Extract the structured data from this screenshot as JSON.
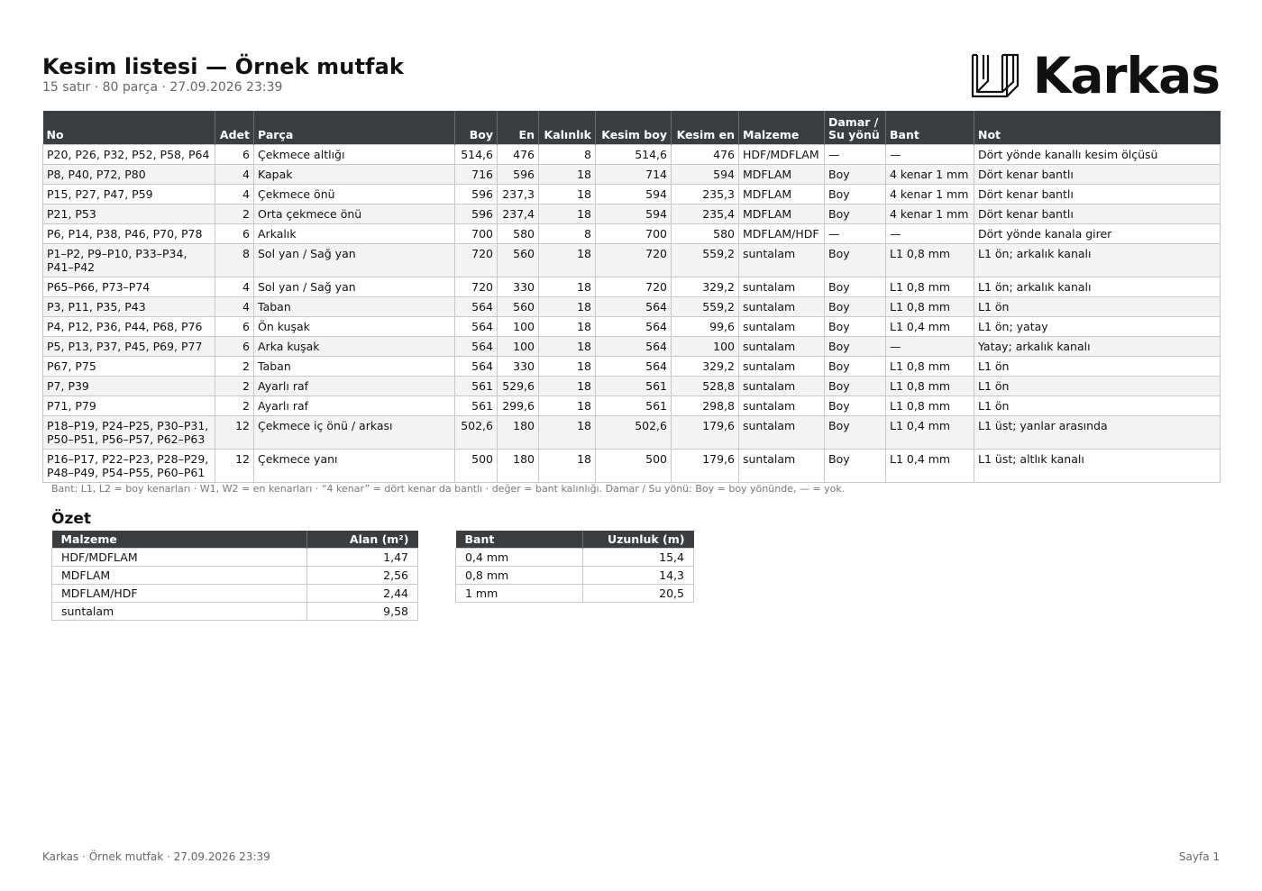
{
  "header": {
    "title": "Kesim listesi — Örnek mutfak",
    "subtitle": "15 satır · 80 parça · 27.09.2026 23:39",
    "brand": "Karkas",
    "logo_icon": "cabinet-outline-icon"
  },
  "table": {
    "columns": {
      "no": "No",
      "adet": "Adet",
      "parca": "Parça",
      "boy": "Boy",
      "en": "En",
      "kalinlik": "Kalınlık",
      "kesim_boy": "Kesim boy",
      "kesim_en": "Kesim en",
      "malzeme": "Malzeme",
      "damar_1": "Damar /",
      "damar_2": "Su yönü",
      "bant": "Bant",
      "not": "Not"
    },
    "rows": [
      {
        "no": "P20, P26, P32, P52, P58, P64",
        "adet": "6",
        "parca": "Çekmece altlığı",
        "boy": "514,6",
        "en": "476",
        "kalinlik": "8",
        "kesim_boy": "514,6",
        "kesim_en": "476",
        "malzeme": "HDF/MDFLAM",
        "damar": "—",
        "bant": "—",
        "not": "Dört yönde kanallı kesim ölçüsü"
      },
      {
        "no": "P8, P40, P72, P80",
        "adet": "4",
        "parca": "Kapak",
        "boy": "716",
        "en": "596",
        "kalinlik": "18",
        "kesim_boy": "714",
        "kesim_en": "594",
        "malzeme": "MDFLAM",
        "damar": "Boy",
        "bant": "4 kenar 1 mm",
        "not": "Dört kenar bantlı"
      },
      {
        "no": "P15, P27, P47, P59",
        "adet": "4",
        "parca": "Çekmece önü",
        "boy": "596",
        "en": "237,3",
        "kalinlik": "18",
        "kesim_boy": "594",
        "kesim_en": "235,3",
        "malzeme": "MDFLAM",
        "damar": "Boy",
        "bant": "4 kenar 1 mm",
        "not": "Dört kenar bantlı"
      },
      {
        "no": "P21, P53",
        "adet": "2",
        "parca": "Orta çekmece önü",
        "boy": "596",
        "en": "237,4",
        "kalinlik": "18",
        "kesim_boy": "594",
        "kesim_en": "235,4",
        "malzeme": "MDFLAM",
        "damar": "Boy",
        "bant": "4 kenar 1 mm",
        "not": "Dört kenar bantlı"
      },
      {
        "no": "P6, P14, P38, P46, P70, P78",
        "adet": "6",
        "parca": "Arkalık",
        "boy": "700",
        "en": "580",
        "kalinlik": "8",
        "kesim_boy": "700",
        "kesim_en": "580",
        "malzeme": "MDFLAM/HDF",
        "damar": "—",
        "bant": "—",
        "not": "Dört yönde kanala girer"
      },
      {
        "no": "P1–P2, P9–P10, P33–P34, P41–P42",
        "adet": "8",
        "parca": "Sol yan / Sağ yan",
        "boy": "720",
        "en": "560",
        "kalinlik": "18",
        "kesim_boy": "720",
        "kesim_en": "559,2",
        "malzeme": "suntalam",
        "damar": "Boy",
        "bant": "L1 0,8 mm",
        "not": "L1 ön; arkalık kanalı"
      },
      {
        "no": "P65–P66, P73–P74",
        "adet": "4",
        "parca": "Sol yan / Sağ yan",
        "boy": "720",
        "en": "330",
        "kalinlik": "18",
        "kesim_boy": "720",
        "kesim_en": "329,2",
        "malzeme": "suntalam",
        "damar": "Boy",
        "bant": "L1 0,8 mm",
        "not": "L1 ön; arkalık kanalı"
      },
      {
        "no": "P3, P11, P35, P43",
        "adet": "4",
        "parca": "Taban",
        "boy": "564",
        "en": "560",
        "kalinlik": "18",
        "kesim_boy": "564",
        "kesim_en": "559,2",
        "malzeme": "suntalam",
        "damar": "Boy",
        "bant": "L1 0,8 mm",
        "not": "L1 ön"
      },
      {
        "no": "P4, P12, P36, P44, P68, P76",
        "adet": "6",
        "parca": "Ön kuşak",
        "boy": "564",
        "en": "100",
        "kalinlik": "18",
        "kesim_boy": "564",
        "kesim_en": "99,6",
        "malzeme": "suntalam",
        "damar": "Boy",
        "bant": "L1 0,4 mm",
        "not": "L1 ön; yatay"
      },
      {
        "no": "P5, P13, P37, P45, P69, P77",
        "adet": "6",
        "parca": "Arka kuşak",
        "boy": "564",
        "en": "100",
        "kalinlik": "18",
        "kesim_boy": "564",
        "kesim_en": "100",
        "malzeme": "suntalam",
        "damar": "Boy",
        "bant": "—",
        "not": "Yatay; arkalık kanalı"
      },
      {
        "no": "P67, P75",
        "adet": "2",
        "parca": "Taban",
        "boy": "564",
        "en": "330",
        "kalinlik": "18",
        "kesim_boy": "564",
        "kesim_en": "329,2",
        "malzeme": "suntalam",
        "damar": "Boy",
        "bant": "L1 0,8 mm",
        "not": "L1 ön"
      },
      {
        "no": "P7, P39",
        "adet": "2",
        "parca": "Ayarlı raf",
        "boy": "561",
        "en": "529,6",
        "kalinlik": "18",
        "kesim_boy": "561",
        "kesim_en": "528,8",
        "malzeme": "suntalam",
        "damar": "Boy",
        "bant": "L1 0,8 mm",
        "not": "L1 ön"
      },
      {
        "no": "P71, P79",
        "adet": "2",
        "parca": "Ayarlı raf",
        "boy": "561",
        "en": "299,6",
        "kalinlik": "18",
        "kesim_boy": "561",
        "kesim_en": "298,8",
        "malzeme": "suntalam",
        "damar": "Boy",
        "bant": "L1 0,8 mm",
        "not": "L1 ön"
      },
      {
        "no": "P18–P19, P24–P25, P30–P31, P50–P51, P56–P57, P62–P63",
        "adet": "12",
        "parca": "Çekmece iç önü / arkası",
        "boy": "502,6",
        "en": "180",
        "kalinlik": "18",
        "kesim_boy": "502,6",
        "kesim_en": "179,6",
        "malzeme": "suntalam",
        "damar": "Boy",
        "bant": "L1 0,4 mm",
        "not": "L1 üst; yanlar arasında"
      },
      {
        "no": "P16–P17, P22–P23, P28–P29, P48–P49, P54–P55, P60–P61",
        "adet": "12",
        "parca": "Çekmece yanı",
        "boy": "500",
        "en": "180",
        "kalinlik": "18",
        "kesim_boy": "500",
        "kesim_en": "179,6",
        "malzeme": "suntalam",
        "damar": "Boy",
        "bant": "L1 0,4 mm",
        "not": "L1 üst; altlık kanalı"
      }
    ]
  },
  "legend": "Bant: L1, L2 = boy kenarları · W1, W2 = en kenarları · “4 kenar” = dört kenar da bantlı · değer = bant kalınlığı. Damar / Su yönü: Boy = boy yönünde, — = yok.",
  "summary": {
    "title": "Özet",
    "material_table": {
      "headers": [
        "Malzeme",
        "Alan (m²)"
      ],
      "rows": [
        [
          "HDF/MDFLAM",
          "1,47"
        ],
        [
          "MDFLAM",
          "2,56"
        ],
        [
          "MDFLAM/HDF",
          "2,44"
        ],
        [
          "suntalam",
          "9,58"
        ]
      ]
    },
    "band_table": {
      "headers": [
        "Bant",
        "Uzunluk (m)"
      ],
      "rows": [
        [
          "0,4 mm",
          "15,4"
        ],
        [
          "0,8 mm",
          "14,3"
        ],
        [
          "1 mm",
          "20,5"
        ]
      ]
    }
  },
  "footer": {
    "left": "Karkas · Örnek mutfak · 27.09.2026 23:39",
    "right": "Sayfa 1"
  }
}
